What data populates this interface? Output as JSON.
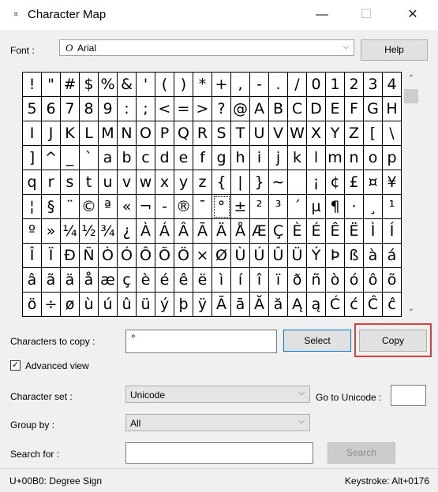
{
  "window": {
    "title": "Character Map",
    "icons": [
      "character-map-icon",
      "minimize-icon",
      "maximize-icon",
      "close-icon"
    ],
    "minimize_glyph": "—",
    "maximize_glyph": "☐",
    "close_glyph": "✕",
    "app_glyph": "ᵃ"
  },
  "font": {
    "label": "Font :",
    "value": "Arial",
    "prefix": "O"
  },
  "help_label": "Help",
  "characters": [
    "!",
    "\"",
    "#",
    "$",
    "%",
    "&",
    "'",
    "(",
    ")",
    "*",
    "+",
    ",",
    "-",
    ".",
    "/",
    "0",
    "1",
    "2",
    "3",
    "4",
    "5",
    "6",
    "7",
    "8",
    "9",
    ":",
    ";",
    "<",
    "=",
    ">",
    "?",
    "@",
    "A",
    "B",
    "C",
    "D",
    "E",
    "F",
    "G",
    "H",
    "I",
    "J",
    "K",
    "L",
    "M",
    "N",
    "O",
    "P",
    "Q",
    "R",
    "S",
    "T",
    "U",
    "V",
    "W",
    "X",
    "Y",
    "Z",
    "[",
    "\\",
    "]",
    "^",
    "_",
    "`",
    "a",
    "b",
    "c",
    "d",
    "e",
    "f",
    "g",
    "h",
    "i",
    "j",
    "k",
    "l",
    "m",
    "n",
    "o",
    "p",
    "q",
    "r",
    "s",
    "t",
    "u",
    "v",
    "w",
    "x",
    "y",
    "z",
    "{",
    "|",
    "}",
    "~",
    " ",
    "¡",
    "¢",
    "£",
    "¤",
    "¥",
    "¦",
    "§",
    "¨",
    "©",
    "ª",
    "«",
    "¬",
    "-",
    "®",
    "¯",
    "°",
    "±",
    "²",
    "³",
    "´",
    "µ",
    "¶",
    "·",
    "¸",
    "¹",
    "º",
    "»",
    "¼",
    "½",
    "¾",
    "¿",
    "À",
    "Á",
    "Â",
    "Ã",
    "Ä",
    "Å",
    "Æ",
    "Ç",
    "È",
    "É",
    "Ê",
    "Ë",
    "Ì",
    "Í",
    "Î",
    "Ï",
    "Ð",
    "Ñ",
    "Ò",
    "Ó",
    "Ô",
    "Õ",
    "Ö",
    "×",
    "Ø",
    "Ù",
    "Ú",
    "Û",
    "Ü",
    "Ý",
    "Þ",
    "ß",
    "à",
    "á",
    "â",
    "ã",
    "ä",
    "å",
    "æ",
    "ç",
    "è",
    "é",
    "ê",
    "ë",
    "ì",
    "í",
    "î",
    "ï",
    "ð",
    "ñ",
    "ò",
    "ó",
    "ô",
    "õ",
    "ö",
    "÷",
    "ø",
    "ù",
    "ú",
    "û",
    "ü",
    "ý",
    "þ",
    "ÿ",
    "Ā",
    "ā",
    "Ă",
    "ă",
    "Ą",
    "ą",
    "Ć",
    "ć",
    "Ĉ",
    "ĉ"
  ],
  "selected_index": 110,
  "copy": {
    "label": "Characters to copy :",
    "value": "°",
    "select_label": "Select",
    "copy_label": "Copy"
  },
  "advanced_view": {
    "label": "Advanced view",
    "checked": true,
    "mark": "✓"
  },
  "character_set": {
    "label": "Character set :",
    "value": "Unicode"
  },
  "goto_unicode": {
    "label": "Go to Unicode :",
    "value": ""
  },
  "group_by": {
    "label": "Group by :",
    "value": "All"
  },
  "search": {
    "label": "Search for :",
    "value": "",
    "button_label": "Search"
  },
  "status": {
    "left": "U+00B0: Degree Sign",
    "right": "Keystroke: Alt+0176"
  },
  "scroll": {
    "up": "⌃",
    "down": "⌄"
  },
  "dropdown_glyph": "⌵"
}
